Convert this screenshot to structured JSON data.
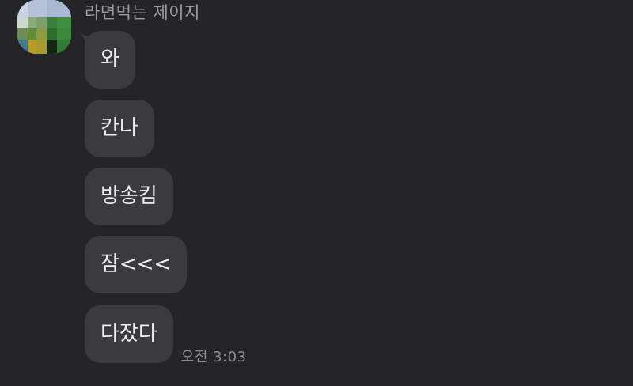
{
  "chat": {
    "sender": {
      "name": "라면먹는 제이지",
      "avatar_icon": "blurred-profile-avatar"
    },
    "messages": [
      {
        "text": "와"
      },
      {
        "text": "칸나"
      },
      {
        "text": "방송킴"
      },
      {
        "text": "잠<<<"
      },
      {
        "text": "다잤다"
      }
    ],
    "timestamp": "오전 3:03"
  },
  "colors": {
    "background": "#252527",
    "bubble": "#3b3b3e",
    "bubble_text": "#ededef",
    "meta_text": "#9a9a9d"
  }
}
